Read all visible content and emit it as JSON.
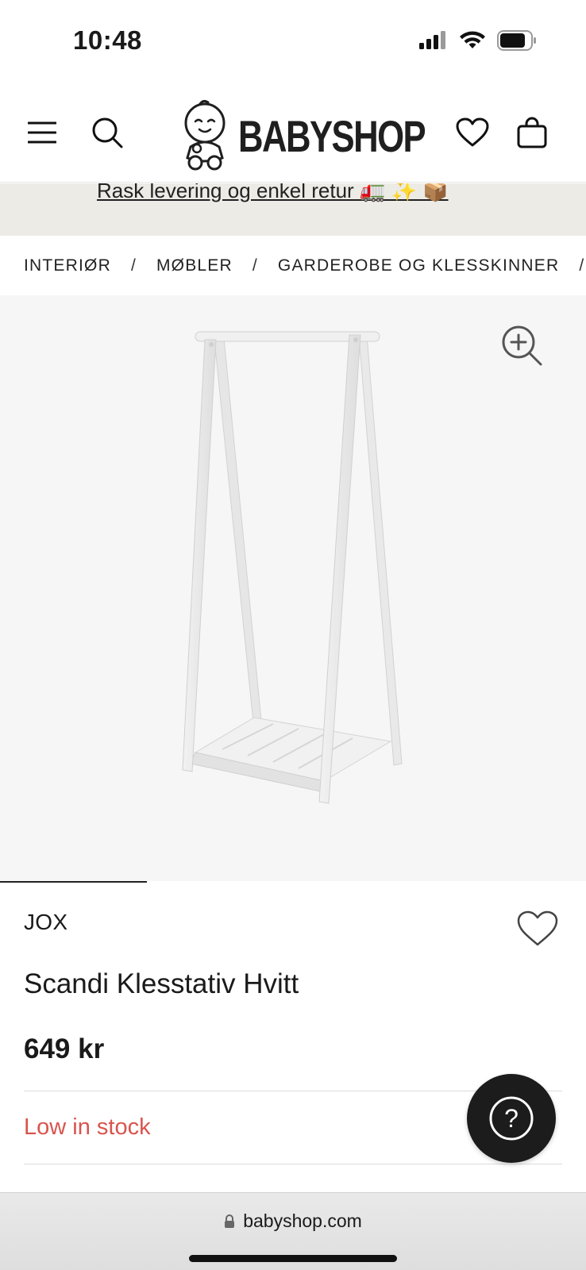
{
  "status_bar": {
    "time": "10:48"
  },
  "header": {
    "logo_text": "BABYSHOP",
    "icons": [
      "menu-icon",
      "search-icon",
      "heart-icon",
      "shopping-bag-icon"
    ]
  },
  "promo": {
    "text": "Rask levering og enkel retur 🚛 ✨ 📦"
  },
  "breadcrumb": {
    "items": [
      "INTERIØR",
      "MØBLER",
      "GARDEROBE OG KLESSKINNER"
    ],
    "separator": "/"
  },
  "product": {
    "brand": "JOX",
    "name": "Scandi Klesstativ Hvitt",
    "price": "649 kr",
    "stock_status": "Low in stock",
    "image_index": 1,
    "image_count": 4
  },
  "help": {
    "label": "?"
  },
  "browser": {
    "url": "babyshop.com"
  },
  "colors": {
    "accent_dark": "#1c1c1c",
    "stock_warning": "#d9544f",
    "promo_bg": "#ecebe6",
    "gallery_bg": "#f6f6f6"
  }
}
